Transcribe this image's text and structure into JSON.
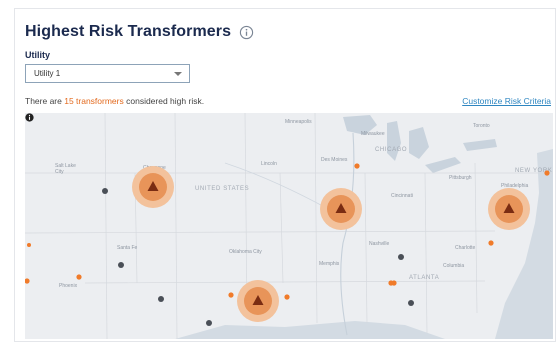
{
  "title": "Highest Risk Transformers",
  "utility": {
    "label": "Utility",
    "selected": "Utility 1"
  },
  "summary": {
    "prefix": "There are ",
    "count_text": "15 transformers",
    "suffix": " considered high risk."
  },
  "customize_link": "Customize Risk Criteria",
  "icons": {
    "title_info": "info-circle-icon",
    "map_info": "info-filled-icon",
    "risk_marker": "warning-triangle-icon",
    "dropdown": "chevron-down-icon"
  },
  "colors": {
    "title": "#1b2a4e",
    "accent": "#e36a1e",
    "link": "#2e86c1",
    "high_risk_ring": "#f0a873",
    "high_risk_core": "#d4572a",
    "medium_dot": "#f07b2a",
    "low_dot": "#4a4f57",
    "water": "#c9d3dd",
    "land": "#eceef1"
  },
  "map": {
    "labels": [
      {
        "text": "UNITED STATES",
        "kind": "big"
      },
      {
        "text": "CHICAGO",
        "kind": "big"
      },
      {
        "text": "NEW YORK",
        "kind": "big"
      },
      {
        "text": "ATLANTA",
        "kind": "big"
      },
      {
        "text": "Cheyenne",
        "kind": "city"
      },
      {
        "text": "Salt Lake City",
        "kind": "city"
      },
      {
        "text": "Lincoln",
        "kind": "city"
      },
      {
        "text": "Des Moines",
        "kind": "city"
      },
      {
        "text": "Milwaukee",
        "kind": "city"
      },
      {
        "text": "Toronto",
        "kind": "city"
      },
      {
        "text": "Pittsburgh",
        "kind": "city"
      },
      {
        "text": "Philadelphia",
        "kind": "city"
      },
      {
        "text": "Cincinnati",
        "kind": "city"
      },
      {
        "text": "Santa Fe",
        "kind": "city"
      },
      {
        "text": "Phoenix",
        "kind": "city"
      },
      {
        "text": "Oklahoma City",
        "kind": "city"
      },
      {
        "text": "Nashville",
        "kind": "city"
      },
      {
        "text": "Charlotte",
        "kind": "city"
      },
      {
        "text": "Memphis",
        "kind": "city"
      },
      {
        "text": "Columbia",
        "kind": "city"
      },
      {
        "text": "Minneapolis",
        "kind": "city"
      }
    ]
  }
}
